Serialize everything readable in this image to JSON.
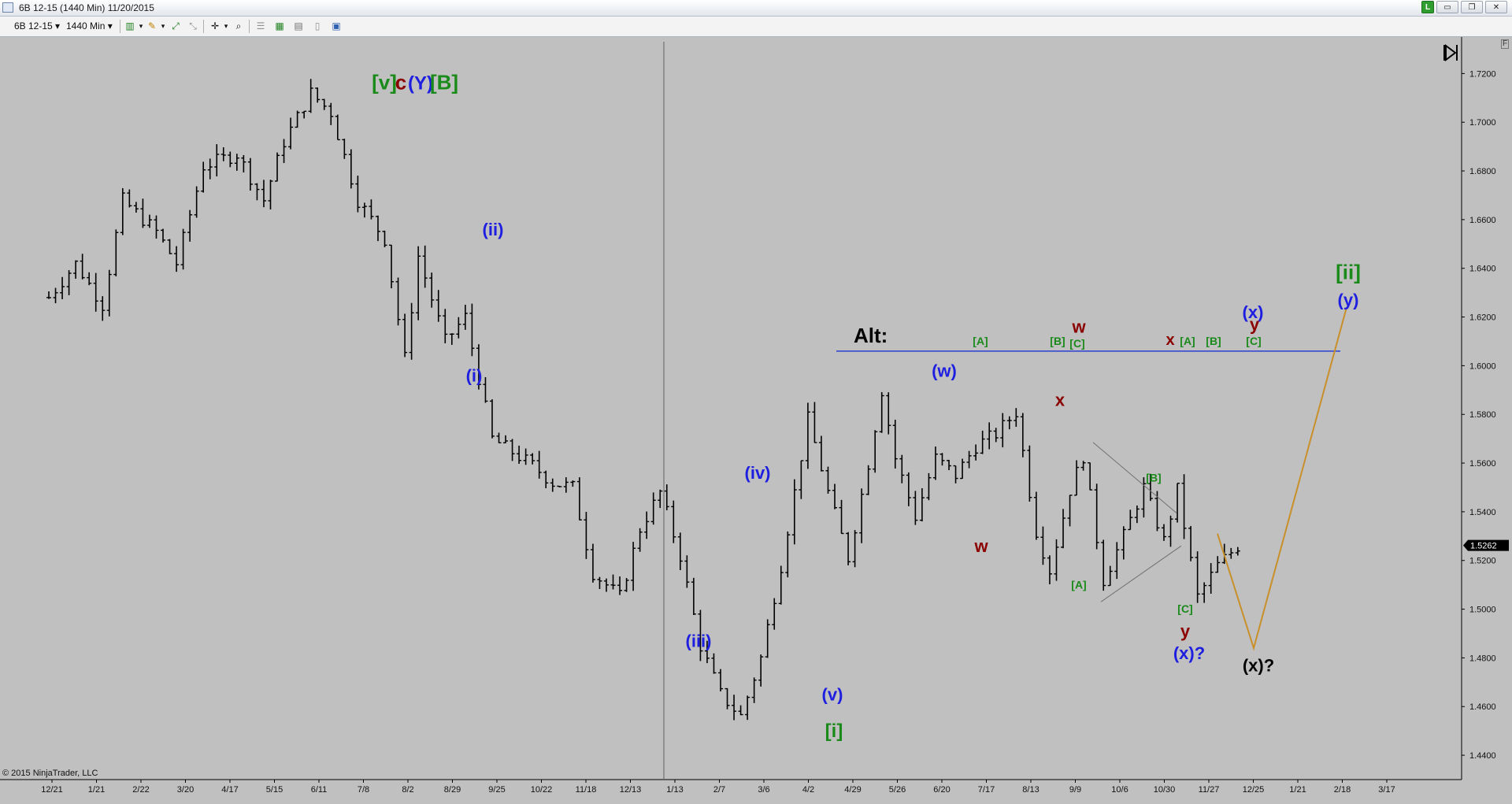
{
  "window": {
    "title": "6B 12-15 (1440 Min)  11/20/2015",
    "buttons": [
      "L",
      "▭",
      "❐",
      "✕"
    ]
  },
  "toolbar": {
    "instrument": "6B 12-15",
    "interval": "1440 Min"
  },
  "copyright": "© 2015 NinjaTrader, LLC",
  "panel_flag": "F",
  "colors": {
    "background": "#c0c0c0",
    "bars": "#000000",
    "wave_blue": "#1e1ee0",
    "wave_green": "#1a8a1a",
    "wave_darkred": "#8b0000",
    "wave_black": "#000000",
    "alt_line": "#2a3fd0",
    "projection": "#c8902a",
    "triangle": "#707070"
  },
  "chart_data": {
    "type": "candlestick",
    "instrument": "6B 12-15",
    "interval": "1440 Min",
    "ylim": [
      1.43,
      1.735
    ],
    "y_ticks": [
      "1.7200",
      "1.7000",
      "1.6800",
      "1.6600",
      "1.6400",
      "1.6200",
      "1.6000",
      "1.5800",
      "1.5600",
      "1.5400",
      "1.5200",
      "1.5000",
      "1.4800",
      "1.4600",
      "1.4400"
    ],
    "x_ticks": [
      "12/21",
      "1/21",
      "2/22",
      "3/20",
      "4/17",
      "5/15",
      "6/11",
      "7/8",
      "8/2",
      "8/29",
      "9/25",
      "10/22",
      "11/18",
      "12/13",
      "1/13",
      "2/7",
      "3/6",
      "4/2",
      "4/29",
      "5/26",
      "6/20",
      "7/17",
      "8/13",
      "9/9",
      "10/6",
      "10/30",
      "11/27",
      "12/25",
      "1/21",
      "2/18",
      "3/17"
    ],
    "last_price": "1.5262",
    "price_path_anchors": [
      [
        0,
        1.628
      ],
      [
        4,
        1.642
      ],
      [
        8,
        1.625
      ],
      [
        11,
        1.668
      ],
      [
        16,
        1.655
      ],
      [
        19,
        1.642
      ],
      [
        23,
        1.682
      ],
      [
        28,
        1.687
      ],
      [
        32,
        1.668
      ],
      [
        35,
        1.692
      ],
      [
        39,
        1.712
      ],
      [
        42,
        1.704
      ],
      [
        46,
        1.668
      ],
      [
        50,
        1.652
      ],
      [
        53,
        1.603
      ],
      [
        55,
        1.645
      ],
      [
        59,
        1.61
      ],
      [
        62,
        1.62
      ],
      [
        66,
        1.57
      ],
      [
        72,
        1.559
      ],
      [
        75,
        1.552
      ],
      [
        78,
        1.55
      ],
      [
        81,
        1.515
      ],
      [
        85,
        1.505
      ],
      [
        88,
        1.533
      ],
      [
        91,
        1.548
      ],
      [
        94,
        1.522
      ],
      [
        97,
        1.485
      ],
      [
        100,
        1.465
      ],
      [
        103,
        1.456
      ],
      [
        106,
        1.48
      ],
      [
        109,
        1.518
      ],
      [
        113,
        1.578
      ],
      [
        116,
        1.548
      ],
      [
        119,
        1.521
      ],
      [
        122,
        1.56
      ],
      [
        124,
        1.59
      ],
      [
        126,
        1.562
      ],
      [
        129,
        1.538
      ],
      [
        132,
        1.562
      ],
      [
        135,
        1.555
      ],
      [
        138,
        1.567
      ],
      [
        141,
        1.572
      ],
      [
        144,
        1.581
      ],
      [
        147,
        1.532
      ],
      [
        149,
        1.516
      ],
      [
        152,
        1.549
      ],
      [
        154,
        1.563
      ],
      [
        157,
        1.512
      ],
      [
        160,
        1.53
      ],
      [
        163,
        1.55
      ],
      [
        166,
        1.528
      ],
      [
        168,
        1.549
      ],
      [
        171,
        1.505
      ],
      [
        174,
        1.518
      ],
      [
        177,
        1.526
      ]
    ],
    "price_path_note": "Piecewise approximation; segment 0-177 spans 12/21 to 11/20/2015",
    "wave_labels": [
      {
        "text": "[v]",
        "color": "green"
      },
      {
        "text": "c",
        "color": "darkred"
      },
      {
        "text": "(Y)",
        "color": "blue"
      },
      {
        "text": "[B]",
        "color": "green"
      },
      {
        "text": "(ii)",
        "color": "blue"
      },
      {
        "text": "(i)",
        "color": "blue"
      },
      {
        "text": "(iii)",
        "color": "blue"
      },
      {
        "text": "(iv)",
        "color": "blue"
      },
      {
        "text": "(v)",
        "color": "blue"
      },
      {
        "text": "[i]",
        "color": "green"
      },
      {
        "text": "(w)",
        "color": "blue"
      },
      {
        "text": "w",
        "color": "darkred"
      },
      {
        "text": "x",
        "color": "darkred"
      },
      {
        "text": "[A]",
        "color": "green"
      },
      {
        "text": "[B]",
        "color": "green"
      },
      {
        "text": "[C]",
        "color": "green"
      },
      {
        "text": "y",
        "color": "darkred"
      },
      {
        "text": "(x)?",
        "color": "blue"
      },
      {
        "text": "(x)?",
        "color": "black"
      },
      {
        "text": "[ii]",
        "color": "green"
      },
      {
        "text": "(y)",
        "color": "blue"
      }
    ],
    "alt_labels": [
      {
        "text": "Alt:",
        "color": "black"
      },
      {
        "text": "[A]",
        "color": "green"
      },
      {
        "text": "[B]",
        "color": "green"
      },
      {
        "text": "[C]",
        "color": "green"
      },
      {
        "text": "w",
        "color": "darkred"
      },
      {
        "text": "x",
        "color": "darkred"
      },
      {
        "text": "[A]",
        "color": "green"
      },
      {
        "text": "[B]",
        "color": "green"
      },
      {
        "text": "(x)",
        "color": "blue"
      },
      {
        "text": "y",
        "color": "darkred"
      },
      {
        "text": "[C]",
        "color": "green"
      }
    ],
    "alt_line_level": 1.606,
    "projection_path": [
      [
        1.531
      ],
      [
        1.484
      ],
      [
        1.624
      ]
    ],
    "triangle_trendlines": true
  }
}
